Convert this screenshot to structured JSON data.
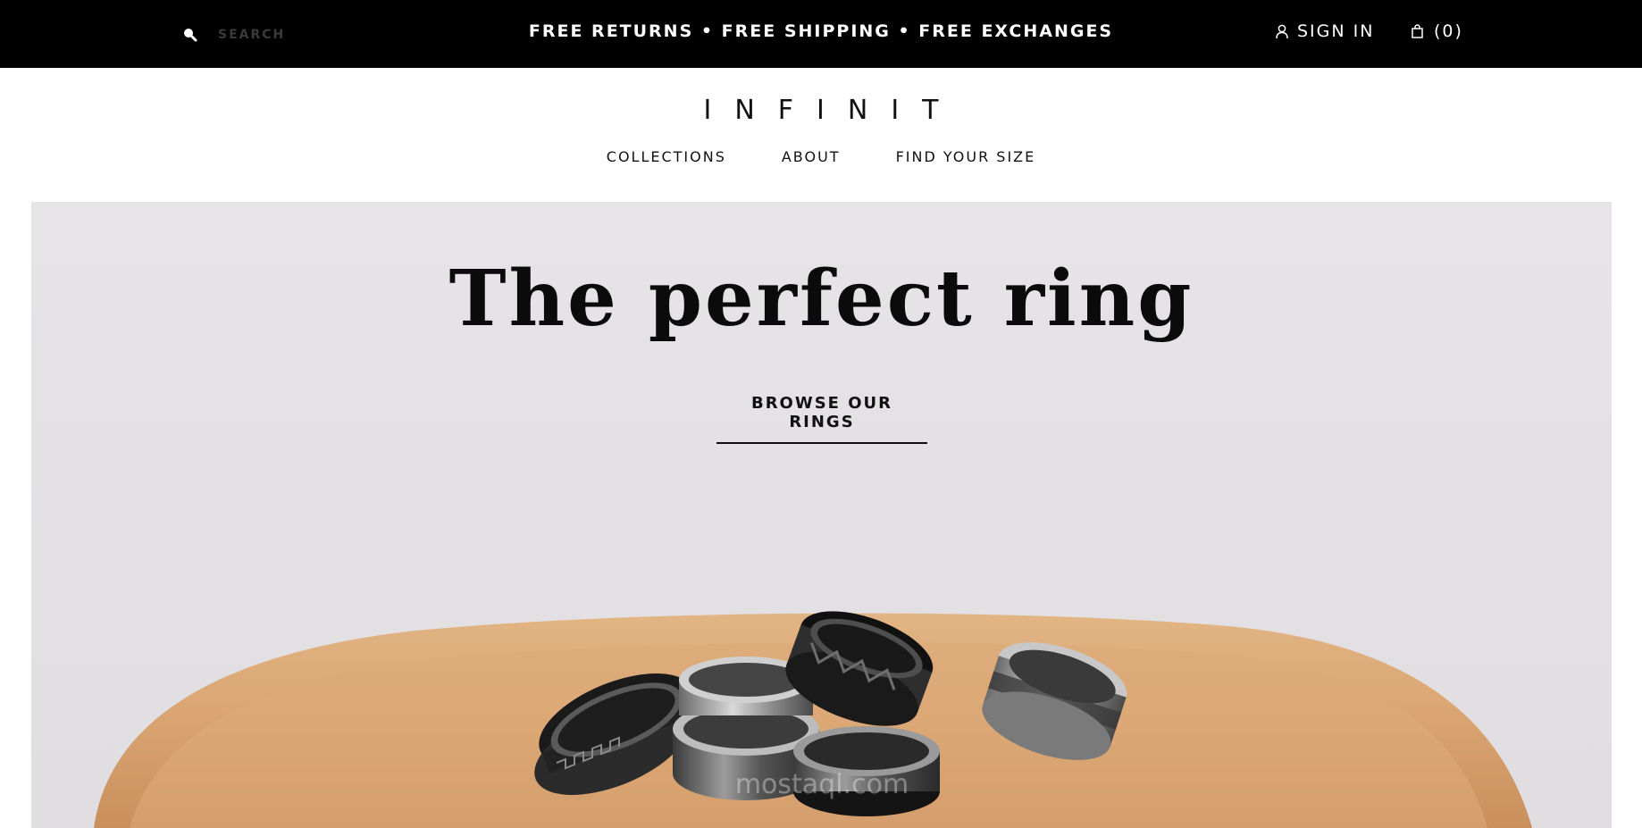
{
  "topbar": {
    "search_placeholder": "SEARCH",
    "promo": "FREE RETURNS • FREE SHIPPING • FREE EXCHANGES",
    "sign_in": "SIGN IN",
    "cart_count": "(0)",
    "icons": [
      "search-icon",
      "user-icon",
      "shopping-bag-icon"
    ]
  },
  "header": {
    "logo": "INFINIT",
    "nav": [
      "COLLECTIONS",
      "ABOUT",
      "FIND YOUR SIZE"
    ]
  },
  "hero": {
    "title": "The perfect ring",
    "cta": "BROWSE OUR RINGS",
    "watermark_text": "mostaql.com"
  },
  "colors": {
    "topbar_bg": "#000000",
    "hero_bg": "#e4e2e5",
    "tray": "#d9a472"
  }
}
